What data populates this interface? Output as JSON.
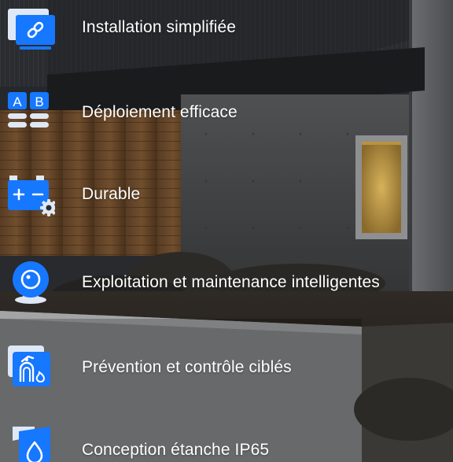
{
  "features": [
    {
      "label": "Installation simplifiée",
      "icon": "monitor-link-icon"
    },
    {
      "label": "Déploiement efficace",
      "icon": "ab-cards-icon",
      "icon_text_a": "A",
      "icon_text_b": "B"
    },
    {
      "label": "Durable",
      "icon": "battery-gear-icon"
    },
    {
      "label": "Exploitation et maintenance intelligentes",
      "icon": "camera-icon"
    },
    {
      "label": "Prévention et contrôle ciblés",
      "icon": "fire-hydrant-icon"
    },
    {
      "label": "Conception étanche IP65",
      "icon": "water-drop-shield-icon"
    }
  ],
  "colors": {
    "icon_blue": "#1677ff",
    "icon_light": "#dfe8f5",
    "text": "#ffffff"
  }
}
